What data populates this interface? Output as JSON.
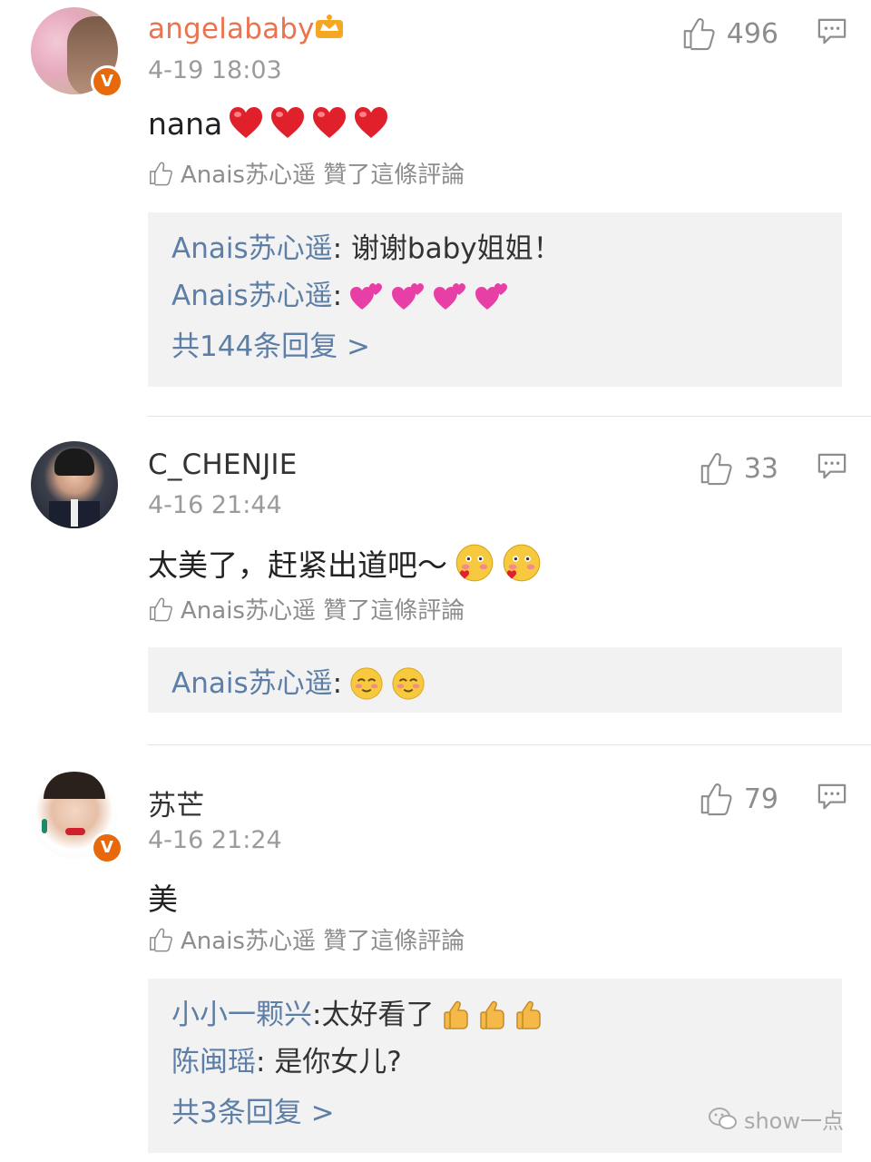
{
  "comments": [
    {
      "username": "angelababy",
      "time": "4-19 18:03",
      "text": "nana",
      "like_count": "496",
      "liked_by": "Anais苏心遥 贊了這條評論",
      "replies": [
        {
          "name": "Anais苏心遥",
          "text": "谢谢baby姐姐！"
        },
        {
          "name": "Anais苏心遥",
          "text": ""
        }
      ],
      "more": "共144条回复 >"
    },
    {
      "username": "C_CHENJIE",
      "time": "4-16 21:44",
      "text": "太美了，赶紧出道吧～",
      "like_count": "33",
      "liked_by": "Anais苏心遥 贊了這條評論",
      "replies": [
        {
          "name": "Anais苏心遥",
          "text": ""
        }
      ]
    },
    {
      "username": "苏芒",
      "time": "4-16 21:24",
      "text": "美",
      "like_count": "79",
      "liked_by": "Anais苏心遥 贊了這條評論",
      "replies": [
        {
          "name": "小小一颗兴",
          "text": "太好看了"
        },
        {
          "name": "陈闽瑶",
          "text": "是你女儿?"
        }
      ],
      "more": "共3条回复 >"
    }
  ],
  "watermark": "show一点",
  "colors": {
    "vip_name": "#eb7350",
    "reply_name": "#5d7ea6",
    "badge": "#e8690b"
  }
}
